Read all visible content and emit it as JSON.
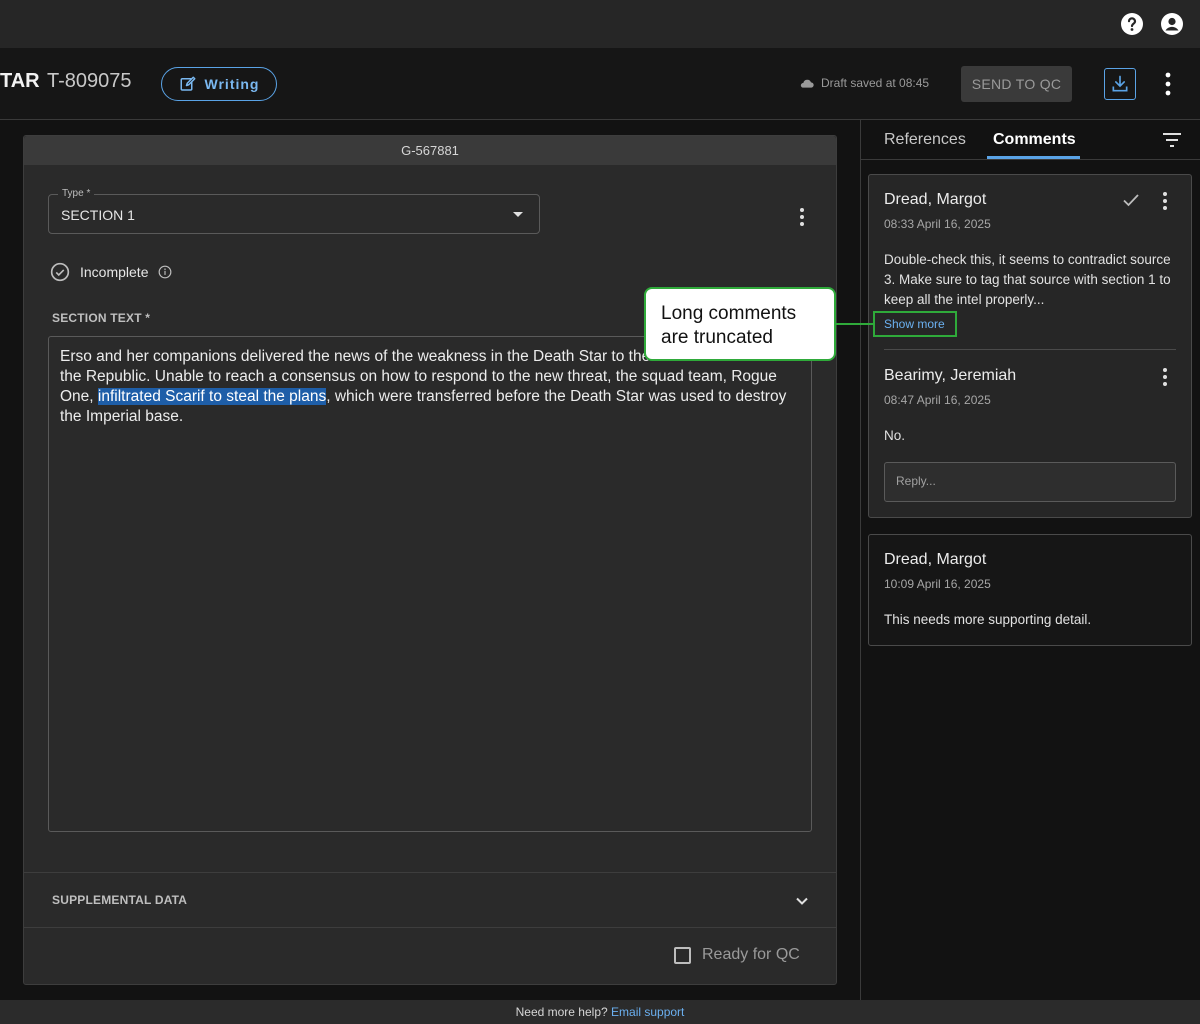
{
  "topbar": {
    "help_icon": "help-circle-icon",
    "account_icon": "account-circle-icon"
  },
  "header": {
    "project": "TAR",
    "ticket": "T-809075",
    "status_label": "Writing",
    "draft_text": "Draft saved at 08:45",
    "send_label": "SEND TO QC"
  },
  "editor": {
    "id": "G-567881",
    "type_label": "Type *",
    "type_value": "SECTION 1",
    "status": "Incomplete",
    "section_label": "SECTION TEXT *",
    "text_before": "Erso and her companions delivered the news of the weakness in the Death Star to the Alliance to Restore the Republic. Unable to reach a consensus on how to respond to the new threat, the squad team, Rogue One, ",
    "text_highlight": "infiltrated Scarif to steal the plans",
    "text_after": ", which were transferred before the Death Star was used to destroy the Imperial base.",
    "supplemental_label": "SUPPLEMENTAL DATA",
    "ready_label": "Ready for QC"
  },
  "panel": {
    "tabs": [
      "References",
      "Comments"
    ],
    "active_tab": "Comments",
    "comments": [
      {
        "author": "Dread, Margot",
        "time": "08:33 April 16, 2025",
        "text": "Double-check this, it seems to contradict source 3. Make sure to tag that source with section 1 to keep all the intel properly...",
        "more": "Show more"
      },
      {
        "author": "Bearimy, Jeremiah",
        "time": "08:47 April 16, 2025",
        "text": "No."
      }
    ],
    "reply_placeholder": "Reply...",
    "resolved_comment": {
      "author": "Dread, Margot",
      "time": "10:09 April 16, 2025",
      "text": "This needs more supporting detail."
    }
  },
  "callout": {
    "text": "Long comments are truncated"
  },
  "footer": {
    "text": "Need more help?",
    "link": "Email support"
  },
  "colors": {
    "accent": "#5aa3e6",
    "highlight": "#1e5ea8",
    "callout_border": "#2faa3a"
  }
}
